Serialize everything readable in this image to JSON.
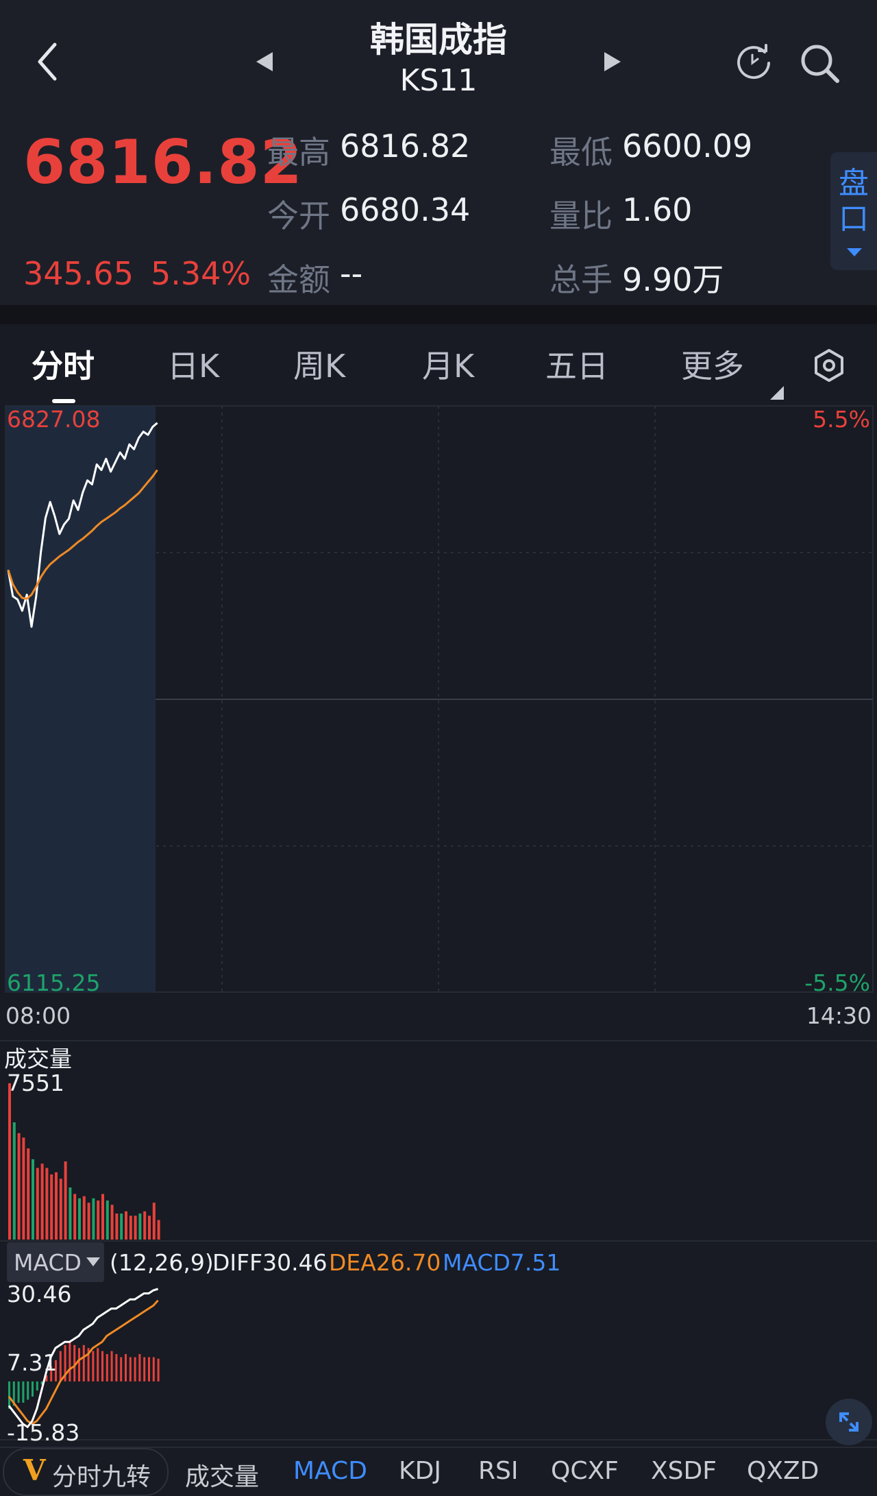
{
  "header": {
    "title": "韩国成指",
    "code": "KS11"
  },
  "quote": {
    "price": "6816.82",
    "change": "345.65",
    "change_pct": "5.34%",
    "stats": [
      {
        "label": "最高",
        "value": "6816.82"
      },
      {
        "label": "最低",
        "value": "6600.09"
      },
      {
        "label": "今开",
        "value": "6680.34"
      },
      {
        "label": "量比",
        "value": "1.60"
      },
      {
        "label": "金额",
        "value": "--"
      },
      {
        "label": "总手",
        "value": "9.90万"
      }
    ],
    "pankou": [
      "盘",
      "口"
    ]
  },
  "tabs": [
    "分时",
    "日K",
    "周K",
    "月K",
    "五日",
    "更多"
  ],
  "colors": {
    "up": "#e8413b",
    "down": "#1ea36a",
    "accent": "#3f8cff",
    "avg": "#f08a25"
  },
  "chart_data": [
    {
      "type": "line",
      "title": "",
      "y_high": "6827.08",
      "y_low": "6115.25",
      "pct_high": "5.5%",
      "pct_low": "-5.5%",
      "x_start": "08:00",
      "x_end": "14:30",
      "ylim": [
        6115.25,
        6827.08
      ],
      "series": [
        {
          "values": [
            6633,
            6600,
            6596,
            6582,
            6602,
            6562,
            6600,
            6655,
            6698,
            6718,
            6700,
            6678,
            6690,
            6697,
            6720,
            6708,
            6730,
            6745,
            6740,
            6765,
            6758,
            6772,
            6756,
            6768,
            6780,
            6772,
            6790,
            6784,
            6798,
            6806,
            6802,
            6812,
            6817
          ]
        },
        {
          "values": [
            6633,
            6615,
            6605,
            6598,
            6597,
            6602,
            6612,
            6624,
            6633,
            6640,
            6645,
            6650,
            6654,
            6658,
            6663,
            6668,
            6672,
            6677,
            6682,
            6688,
            6693,
            6697,
            6701,
            6705,
            6710,
            6714,
            6719,
            6724,
            6729,
            6736,
            6743,
            6750,
            6758
          ]
        }
      ]
    },
    {
      "type": "bar",
      "title": "成交量",
      "max_label": "7551",
      "values": [
        7200,
        5400,
        4900,
        4700,
        4200,
        3700,
        3300,
        3500,
        3300,
        3000,
        3100,
        2800,
        3600,
        2400,
        2100,
        1900,
        2000,
        1700,
        1900,
        1800,
        2100,
        1800,
        1600,
        1200,
        1200,
        1300,
        1100,
        1100,
        1200,
        1300,
        1100,
        1700,
        900
      ],
      "up": [
        true,
        false,
        true,
        true,
        true,
        false,
        true,
        true,
        true,
        true,
        true,
        true,
        true,
        false,
        true,
        false,
        true,
        true,
        false,
        true,
        true,
        false,
        true,
        true,
        false,
        true,
        true,
        true,
        false,
        true,
        true,
        true,
        true
      ]
    },
    {
      "type": "bar",
      "title": "MACD",
      "params": "(12,26,9)",
      "diff_label": "DIFF30.46",
      "dea_label": "DEA26.70",
      "macd_label": "MACD7.51",
      "y_top": "30.46",
      "y_mid": "7.31",
      "y_bottom": "-15.83",
      "ylim": [
        -15.83,
        30.46
      ],
      "values": [
        -9,
        -8,
        -7,
        -7,
        -6,
        -5,
        -3,
        -1,
        2,
        5,
        7,
        10,
        12,
        13,
        12,
        11,
        12,
        11,
        10,
        11,
        10,
        9,
        10,
        9,
        8,
        9,
        8,
        8,
        9,
        8,
        8,
        8,
        7.5
      ],
      "diff": [
        -8,
        -10,
        -12,
        -14,
        -15,
        -13,
        -9,
        -3,
        3,
        8,
        11,
        12,
        13,
        13,
        14,
        15,
        17,
        18,
        19,
        21,
        22,
        23,
        24,
        24,
        25,
        26,
        27,
        27,
        28,
        29,
        29,
        30,
        30.46
      ],
      "dea": [
        -5,
        -7,
        -9,
        -11,
        -13,
        -14,
        -13,
        -11,
        -9,
        -6,
        -3,
        0,
        2,
        4,
        5,
        7,
        8,
        9,
        11,
        12,
        13,
        15,
        16,
        17,
        18,
        19,
        20,
        21,
        22,
        23,
        24,
        25,
        26.7
      ]
    }
  ],
  "bottom_tabs": [
    "分时九转",
    "成交量",
    "MACD",
    "KDJ",
    "RSI",
    "QCXF",
    "XSDF",
    "QXZD"
  ],
  "bottom_logo": "V"
}
